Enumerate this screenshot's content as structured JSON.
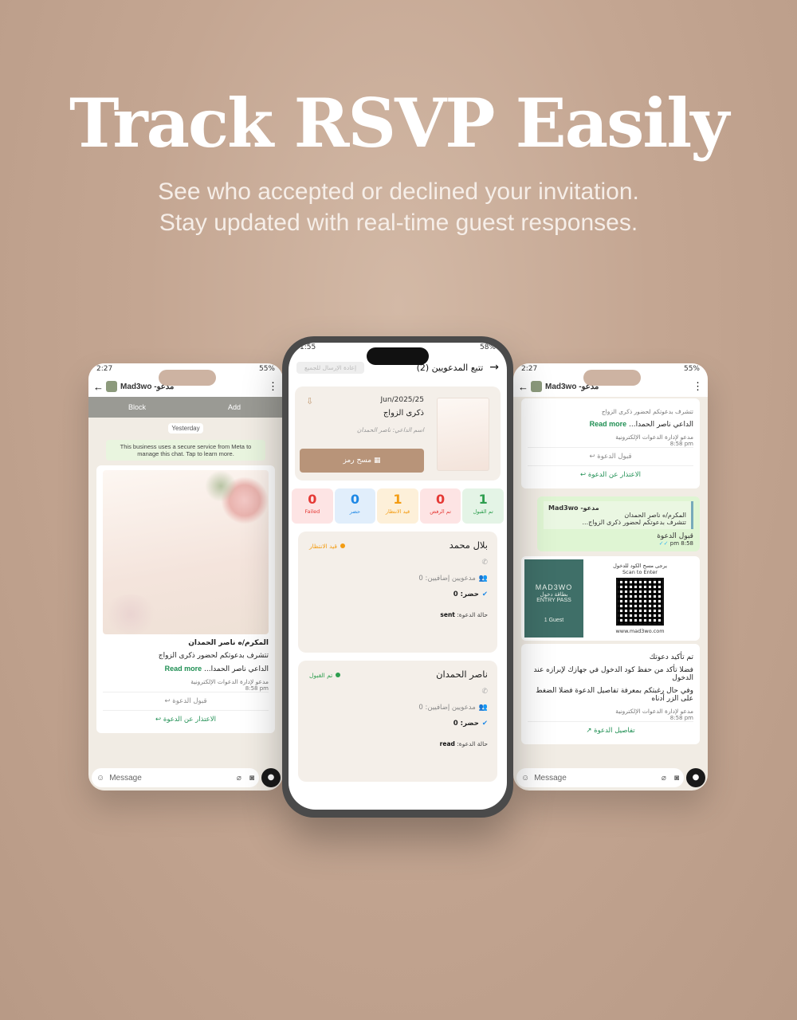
{
  "hero": {
    "title": "Track RSVP Easily",
    "sub1": "See who accepted or declined your invitation.",
    "sub2": "Stay updated with real-time guest responses."
  },
  "left_phone": {
    "time": "2:27",
    "battery": "55%",
    "contact": "Mad3wo -مدعو",
    "block_label": "Block",
    "add_label": "Add",
    "day_chip": "Yesterday",
    "meta_note": "This business uses a secure service from Meta to manage this chat. Tap to learn more.",
    "honoree": "المكرم/ه ناصر الحمدان",
    "invite_line": "تتشرف بدعوتكم لحضور ذكرى الزواج",
    "inviter": "الداعي ناصر الحمدا...",
    "read_more": "Read more",
    "brand": "مدعو لإدارة الدعوات الإلكترونية",
    "time_sent": "8:58 pm",
    "accept_btn": "قبول الدعوة",
    "decline_btn": "الاعتذار عن الدعوة",
    "message_placeholder": "Message"
  },
  "right_phone": {
    "time": "2:27",
    "battery": "55%",
    "contact": "Mad3wo -مدعو",
    "top_line": "تتشرف بدعوتكم لحضور ذكرى الزواج",
    "inviter": "الداعي ناصر الحمدا...",
    "read_more": "Read more",
    "brand": "مدعو لإدارة الدعوات الإلكترونية",
    "time_sent": "8:58 pm",
    "accept_btn": "قبول الدعوة",
    "decline_btn": "الاعتذار عن الدعوة",
    "quote_sender": "Mad3wo -مدعو",
    "quote_honoree": "المكرم/ه ناصر الحمدان",
    "quote_line": "تتشرف بدعوتكم لحضور ذكرى الزواج...",
    "reply_text": "قبول الدعوة",
    "reply_time": "8:58 pm",
    "pass_brand": "MAD3WO",
    "pass_ar": "بطاقة دخول",
    "pass_en": "ENTRY PASS",
    "pass_guests": "1 Guest",
    "pass_scan_ar": "يرجى مسح الكود للدخول",
    "pass_scan_en": "Scan to Enter",
    "pass_url": "www.mad3wo.com",
    "confirm": "تم تأكيد دعوتك",
    "save_code": "فضلا تأكد من حفظ كود الدخول في جهازك لإبرازه عند الدخول",
    "details_note": "وفي حال رغبتكم بمعرفة تفاصيل الدعوة فضلا الضغط على الزر أدناه",
    "details_btn": "تفاصيل الدعوة",
    "message_placeholder": "Message"
  },
  "center_phone": {
    "time": "1:55",
    "battery": "58%",
    "title": "تتبع المدعويين (2)",
    "resend": "إعادة الإرسال للجميع",
    "event": {
      "date": "Jun/2025/25",
      "name": "ذكرى الزواج",
      "inviter": "اسم الداعي: ناصر الحمدان",
      "scan_btn": "مسح رمز"
    },
    "stats": [
      {
        "value": "1",
        "label": "تم القبول",
        "color": "#2e9e4f",
        "bg": "#e4f4e6"
      },
      {
        "value": "0",
        "label": "تم الرفض",
        "color": "#e53935",
        "bg": "#fde4e4"
      },
      {
        "value": "1",
        "label": "قيد الانتظار",
        "color": "#f39c12",
        "bg": "#fdf0d9"
      },
      {
        "value": "0",
        "label": "حضر",
        "color": "#1e88e5",
        "bg": "#e1eefb"
      },
      {
        "value": "0",
        "label": "Failed",
        "color": "#e53935",
        "bg": "#fde4e4"
      }
    ],
    "guests": [
      {
        "name": "بلال محمد",
        "status": "قيد الانتظار",
        "status_color": "#f39c12",
        "extra": "مدعويين إضافيين: 0",
        "attended": "حضر: 0",
        "state_label": "حالة الدعوة:",
        "state": "sent"
      },
      {
        "name": "ناصر الحمدان",
        "status": "تم القبول",
        "status_color": "#2e9e4f",
        "extra": "مدعويين إضافيين: 0",
        "attended": "حضر: 0",
        "state_label": "حالة الدعوة:",
        "state": "read"
      }
    ]
  }
}
